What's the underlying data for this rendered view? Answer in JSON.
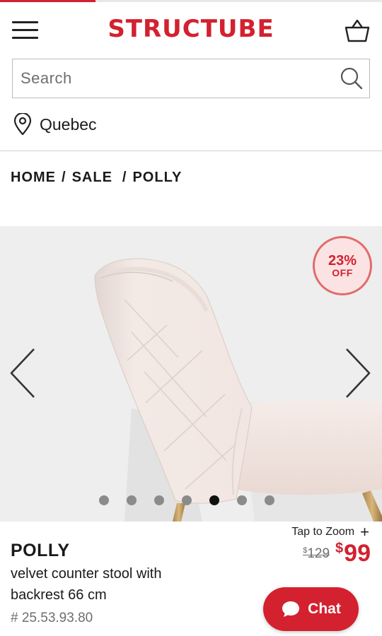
{
  "page_load_progress": 0.25,
  "colors": {
    "brand": "#d3212f",
    "badge_bg": "#fbe3e3",
    "badge_border": "#e36b6b"
  },
  "header": {
    "logo": "STRUCTUBE",
    "menu_icon": "hamburger-menu-icon",
    "cart_icon": "shopping-basket-icon"
  },
  "search": {
    "placeholder": "Search",
    "value": "",
    "icon": "search-icon"
  },
  "location": {
    "icon": "map-pin-icon",
    "label": "Quebec"
  },
  "breadcrumb": {
    "home": "HOME",
    "sale": "SALE",
    "current": "POLLY",
    "separator": "/"
  },
  "gallery": {
    "image_alt": "Blush velvet counter stool with quilted backrest and gold legs",
    "discount_percent": "23%",
    "discount_label": "OFF",
    "prev_icon": "chevron-left-icon",
    "next_icon": "chevron-right-icon",
    "slide_count": 7,
    "active_slide": 5
  },
  "zoom": {
    "label": "Tap to Zoom",
    "plus": "+"
  },
  "product": {
    "name": "POLLY",
    "description": "velvet counter stool with backrest 66 cm",
    "sku": "# 25.53.93.80",
    "old_price_currency": "$",
    "old_price_amount": "129",
    "new_price_currency": "$",
    "new_price_amount": "99"
  },
  "chat": {
    "label": "Chat",
    "icon": "chat-bubble-icon"
  }
}
